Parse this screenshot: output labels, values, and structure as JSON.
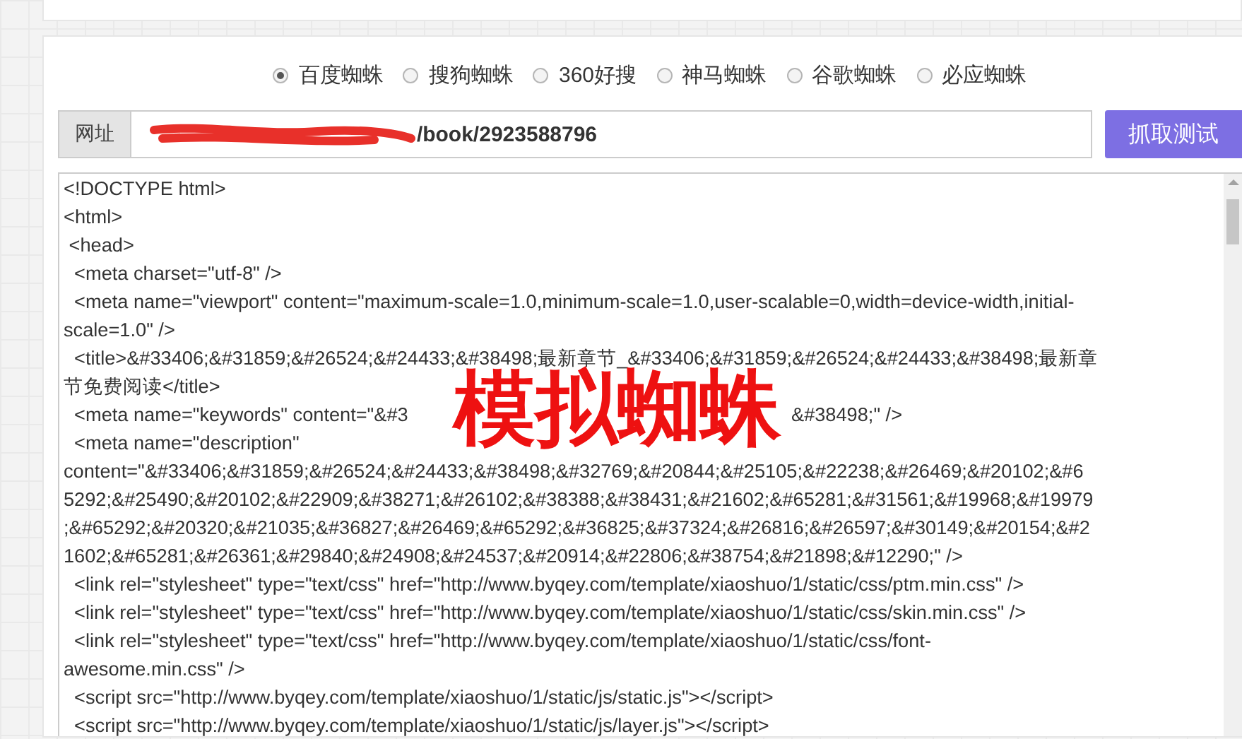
{
  "spiders": [
    {
      "label": "百度蜘蛛",
      "selected": true
    },
    {
      "label": "搜狗蜘蛛",
      "selected": false
    },
    {
      "label": "360好搜",
      "selected": false
    },
    {
      "label": "神马蜘蛛",
      "selected": false
    },
    {
      "label": "谷歌蜘蛛",
      "selected": false
    },
    {
      "label": "必应蜘蛛",
      "selected": false
    }
  ],
  "url_bar": {
    "label": "网址",
    "value": "/book/2923588796",
    "button": "抓取测试"
  },
  "source_lines": [
    {
      "parts": [
        "<!DOCTYPE html>"
      ]
    },
    {
      "parts": [
        "<html>"
      ]
    },
    {
      "parts": [
        " <head>"
      ]
    },
    {
      "parts": [
        "  <meta charset=\"utf-8\" />"
      ]
    },
    {
      "parts": [
        "  <meta name=\"viewport\" content=\"maximum-scale=1.0,minimum-scale=1.0,user-scalable=0,width=device-width,initial-"
      ]
    },
    {
      "parts": [
        "scale=1.0\" />"
      ]
    },
    {
      "parts": [
        "  <title>&#33406;&#31859;&#26524;&#24433;&#38498;最新章节_&#33406;&#31859;&#26524;&#24433;&#38498;最新章"
      ]
    },
    {
      "parts": [
        "节免费阅读</title>"
      ]
    },
    {
      "parts": [
        "  <meta name=\"keywords\" content=\"&#3",
        "&#38498;\" />"
      ]
    },
    {
      "parts": [
        "  <meta name=\"description\""
      ]
    },
    {
      "parts": [
        "content=\"&#33406;&#31859;&#26524;&#24433;&#38498;&#32769;&#20844;&#25105;&#22238;&#26469;&#20102;&#6"
      ]
    },
    {
      "parts": [
        "5292;&#25490;&#20102;&#22909;&#38271;&#26102;&#38388;&#38431;&#21602;&#65281;&#31561;&#19968;&#19979"
      ]
    },
    {
      "parts": [
        ";&#65292;&#20320;&#21035;&#36827;&#26469;&#65292;&#36825;&#37324;&#26816;&#26597;&#30149;&#20154;&#2"
      ]
    },
    {
      "parts": [
        "1602;&#65281;&#26361;&#29840;&#24908;&#24537;&#20914;&#22806;&#38754;&#21898;&#12290;\" />"
      ]
    },
    {
      "parts": [
        "  <link rel=\"stylesheet\" type=\"text/css\" href=\"http://www.byqey.com/template/xiaoshuo/1/static/css/ptm.min.css\" />"
      ]
    },
    {
      "parts": [
        "  <link rel=\"stylesheet\" type=\"text/css\" href=\"http://www.byqey.com/template/xiaoshuo/1/static/css/skin.min.css\" />"
      ]
    },
    {
      "parts": [
        "  <link rel=\"stylesheet\" type=\"text/css\" href=\"http://www.byqey.com/template/xiaoshuo/1/static/css/font-"
      ]
    },
    {
      "parts": [
        "awesome.min.css\" />"
      ]
    },
    {
      "parts": [
        "  <script src=\"http://www.byqey.com/template/xiaoshuo/1/static/js/static.js\"></script>"
      ]
    },
    {
      "parts": [
        "  <script src=\"http://www.byqey.com/template/xiaoshuo/1/static/js/layer.js\"></script>"
      ]
    }
  ],
  "overlay_caption": "模拟蜘蛛"
}
